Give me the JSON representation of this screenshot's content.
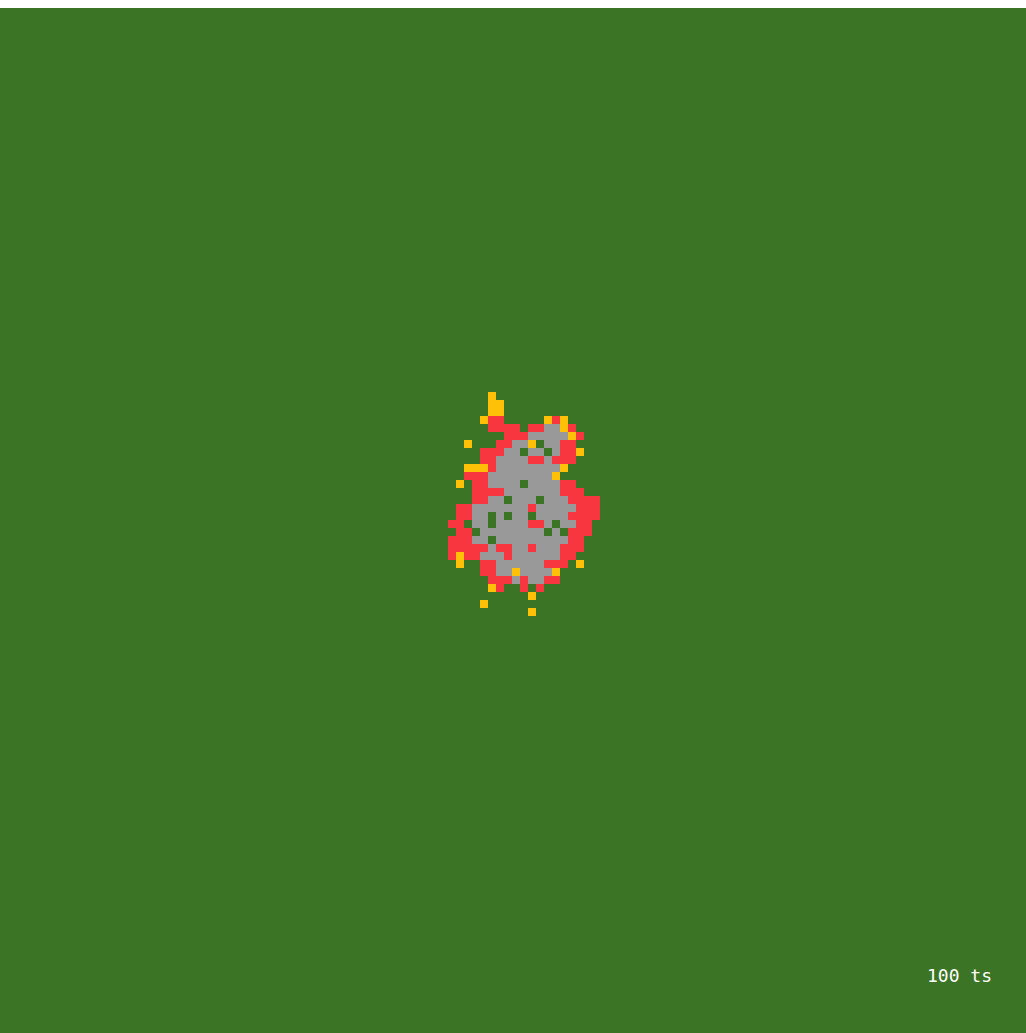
{
  "simulation": {
    "counter": "100 ts",
    "states": [
      {
        "symbol": ".",
        "kind": "unburnt",
        "color": "#3c7425"
      },
      {
        "symbol": "r",
        "kind": "burning",
        "color": "#f8363f"
      },
      {
        "symbol": "y",
        "kind": "igniting",
        "color": "#ffc107"
      },
      {
        "symbol": "a",
        "kind": "ash",
        "color": "#999999"
      }
    ],
    "grid": {
      "rows": [
        ".......y...............",
        ".......yy..............",
        ".......yy..............",
        "......yrr.....yry......",
        ".......rrrr.rraayr.....",
        ".........rrraaaaayr....",
        "....y...rraay.aarr.....",
        "......rrraa.aa.arry....",
        "......rraaaarrarrr.....",
        "....yyyraaaaaaaay......",
        "....rrraaaaaaaay.......",
        "...y.rraaaa.aaaarr.....",
        ".....rrrraaaaaaarrr....",
        ".....rraa.aaa.aaarrrr..",
        "...rraaaaaaaraaaaarrr..",
        "...rraa.a.aa.aaaarrrr..",
        "..rr.aa.aaaarra.aarr...",
        "...rr.aaaaaaaa.a.rrr...",
        "..rrraa.aaaaaaaaarr....",
        "..rrrrrarraaraaarrr....",
        "..ryrraaaraaaaaarr.....",
        "...y..rraaaaaarrr.y....",
        "......rraayaaaay.......",
        ".......rrraraarr.......",
        ".......yr..r.r.........",
        "............y..........",
        "......y................",
        "............y.........."
      ]
    }
  }
}
